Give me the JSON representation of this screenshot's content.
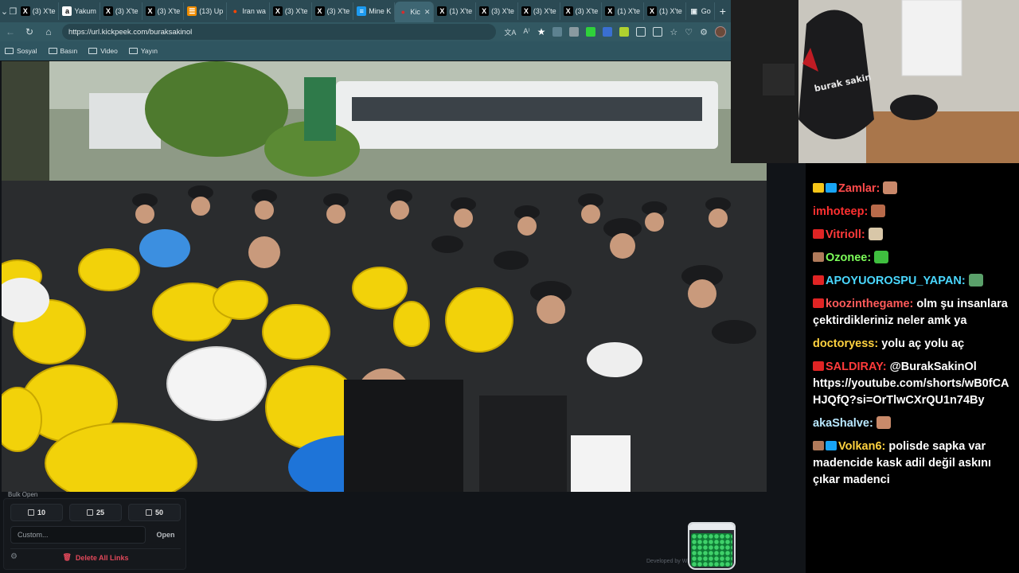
{
  "browser": {
    "tabs": [
      {
        "label": "(3) X'te",
        "fav": "X",
        "favColor": "#000000",
        "favText": "#ffffff"
      },
      {
        "label": "Yakum",
        "fav": "a",
        "favColor": "#ffffff",
        "favText": "#000000"
      },
      {
        "label": "(3) X'te",
        "fav": "X",
        "favColor": "#000000",
        "favText": "#ffffff"
      },
      {
        "label": "(3) X'te",
        "fav": "X",
        "favColor": "#000000",
        "favText": "#ffffff"
      },
      {
        "label": "(13) Up",
        "fav": "☰",
        "favColor": "#f08c00",
        "favText": "#ffffff"
      },
      {
        "label": "Iran wa",
        "fav": "●",
        "favColor": "#2b4a54",
        "favText": "#ff4500"
      },
      {
        "label": "(3) X'te",
        "fav": "X",
        "favColor": "#000000",
        "favText": "#ffffff"
      },
      {
        "label": "(3) X'te",
        "fav": "X",
        "favColor": "#000000",
        "favText": "#ffffff"
      },
      {
        "label": "Mine K",
        "fav": "≡",
        "favColor": "#1d9bf0",
        "favText": "#ffffff"
      },
      {
        "label": "Kic",
        "fav": "●",
        "favColor": "#3e6673",
        "favText": "#d62d2d",
        "active": true
      },
      {
        "label": "(1) X'te",
        "fav": "X",
        "favColor": "#000000",
        "favText": "#ffffff"
      },
      {
        "label": "(3) X'te",
        "fav": "X",
        "favColor": "#000000",
        "favText": "#ffffff"
      },
      {
        "label": "(3) X'te",
        "fav": "X",
        "favColor": "#000000",
        "favText": "#ffffff"
      },
      {
        "label": "(3) X'te",
        "fav": "X",
        "favColor": "#000000",
        "favText": "#ffffff"
      },
      {
        "label": "(1) X'te",
        "fav": "X",
        "favColor": "#000000",
        "favText": "#ffffff"
      },
      {
        "label": "(1) X'te",
        "fav": "X",
        "favColor": "#000000",
        "favText": "#ffffff"
      },
      {
        "label": "Go",
        "fav": "▣",
        "favColor": "#2b4a54",
        "favText": "#e3ecef"
      }
    ],
    "url": "https://url.kickpeek.com/buraksakinol",
    "bookmarks": [
      "Sosyal",
      "Basın",
      "Video",
      "Yayın"
    ]
  },
  "bulk": {
    "label": "Bulk Open",
    "btn10": "10",
    "btn25": "25",
    "btn50": "50",
    "custom_placeholder": "Custom...",
    "open_label": "Open",
    "delete_label": "Delete All Links"
  },
  "footer": {
    "credit": "Developed by                                        WhiteTemplates"
  },
  "webcam": {
    "chair_text": "burak sakin"
  },
  "chat": [
    {
      "user": "Zamlar:",
      "color": "#ff4b4b",
      "text": "",
      "badge": "#f5c518",
      "badge2": "#18a5f5",
      "emote": "#c9886a"
    },
    {
      "user": "imhoteep:",
      "color": "#ff3030",
      "text": "",
      "badge": "",
      "emote": "#b86a4a"
    },
    {
      "user": "Vitrioll:",
      "color": "#ff3b3b",
      "text": "",
      "badge": "#e02424",
      "emote": "#d8c7a8"
    },
    {
      "user": "Ozonee:",
      "color": "#7dff5a",
      "text": "",
      "badge": "#b07a5a",
      "emote": "#3fbf3f"
    },
    {
      "user": "APOYUOROSPU_YAPAN:",
      "color": "#4ad8ff",
      "text": "",
      "badge": "#e02424",
      "emote": "#5aa06a"
    },
    {
      "user": "koozinthegame:",
      "color": "#ff5a5a",
      "text": "olm şu insanlara çektirdikleriniz neler amk ya",
      "badge": "#e02424",
      "emote": ""
    },
    {
      "user": "doctoryess:",
      "color": "#ffd23f",
      "text": "yolu aç yolu aç",
      "badge": "",
      "emote": ""
    },
    {
      "user": "SALDIRAY:",
      "color": "#ff3b3b",
      "text": "@BurakSakinOl https://youtube.com/shorts/wB0fCAHJQfQ?si=OrTlwCXrQU1n74By",
      "badge": "#e02424",
      "emote": ""
    },
    {
      "user": "akaShalve:",
      "color": "#b9e8ff",
      "text": "",
      "badge": "",
      "emote": "#c98a6a"
    },
    {
      "user": "Volkan6:",
      "color": "#ffd23f",
      "text": "polisde sapka var madencide kask adil değil askını çıkar madenci",
      "badge": "#b07a5a",
      "badge2": "#18a5f5",
      "emote": ""
    }
  ]
}
